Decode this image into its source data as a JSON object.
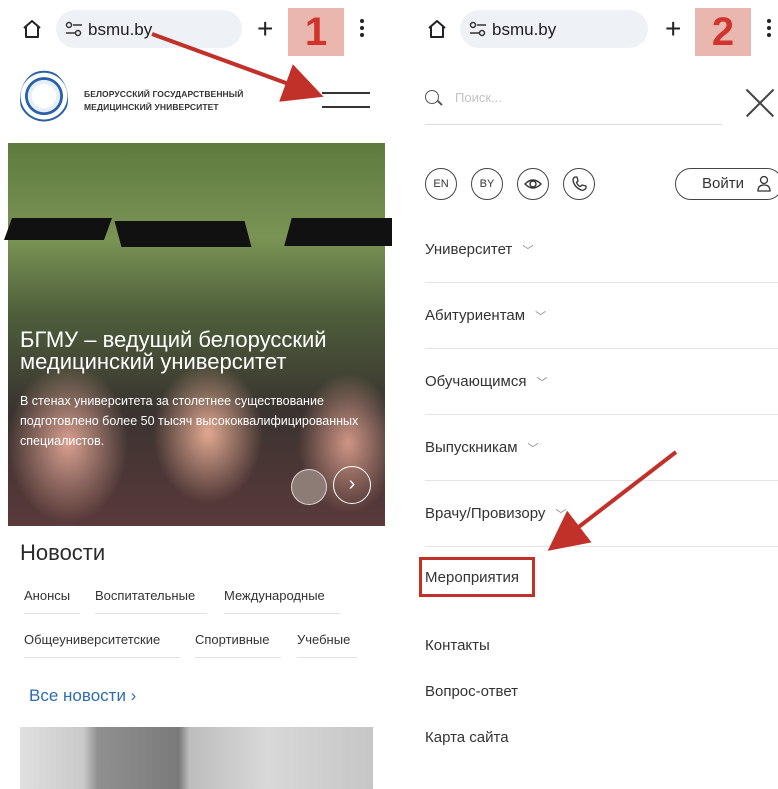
{
  "left": {
    "browser": {
      "url": "bsmu.by",
      "step_badge": "1"
    },
    "header": {
      "university_name_line1": "БЕЛОРУССКИЙ ГОСУДАРСТВЕННЫЙ",
      "university_name_line2": "МЕДИЦИНСКИЙ УНИВЕРСИТЕТ"
    },
    "hero": {
      "title": "БГМУ – ведущий белорусский медицинский университет",
      "text": "В стенах университета за столетнее существование подготовлено более 50 тысяч высококвалифицированных специалистов.",
      "next_glyph": "›"
    },
    "news": {
      "title": "Новости",
      "tags_row1": [
        "Анонсы",
        "Воспитательные",
        "Международные"
      ],
      "tags_row2": [
        "Общеуниверситетские",
        "Спортивные",
        "Учебные"
      ],
      "all_link": "Все новости ›"
    }
  },
  "right": {
    "browser": {
      "url": "bsmu.by",
      "step_badge": "2"
    },
    "search": {
      "placeholder": "Поиск..."
    },
    "lang": [
      "EN",
      "BY"
    ],
    "login": "Войти",
    "menu": [
      "Университет",
      "Абитуриентам",
      "Обучающимся",
      "Выпускникам",
      "Врачу/Провизору"
    ],
    "menu_plain": [
      "Мероприятия",
      "Контакты",
      "Вопрос-ответ",
      "Карта сайта"
    ]
  },
  "colors": {
    "accent": "#2f6bb0",
    "highlight": "#c2302a",
    "badge_bg": "#e9b7ad"
  }
}
